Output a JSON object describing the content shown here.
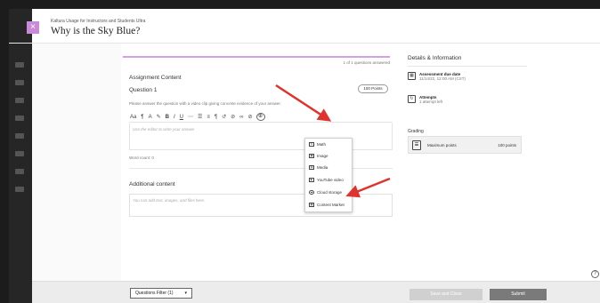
{
  "header": {
    "breadcrumb": "Kaltura Usage for Instructors and Students Ultra",
    "title": "Why is the Sky Blue?",
    "close_symbol": "×"
  },
  "assignment": {
    "progress_text": "1 of 1 questions answered",
    "section_title": "Assignment Content",
    "question_label": "Question 1",
    "points_badge": "100 Points",
    "instructions": "Please answer the question with a video clip giving concrete evidence of your answer.",
    "editor_placeholder": "Use the editor to write your answer",
    "word_count": "Word count: 0",
    "toolbar": [
      "Aa",
      "¶",
      "A",
      "✎",
      "B",
      "I",
      "U",
      "⋯",
      "☰",
      "≡",
      "¶",
      "↺",
      "⊘",
      "∞",
      "⊘",
      "⊕"
    ]
  },
  "additional": {
    "title": "Additional content",
    "placeholder": "You can add text, images, and files here."
  },
  "insert_menu": {
    "items": [
      {
        "label": "Math",
        "icon": "math-icon",
        "glyph": "fx"
      },
      {
        "label": "Image",
        "icon": "image-icon",
        "glyph": "▣"
      },
      {
        "label": "Media",
        "icon": "media-icon",
        "glyph": "▤"
      },
      {
        "label": "YouTube video",
        "icon": "youtube-icon",
        "glyph": "▶"
      },
      {
        "label": "Cloud storage",
        "icon": "cloud-icon",
        "glyph": "☁"
      },
      {
        "label": "Content Market",
        "icon": "content-market-icon",
        "glyph": "▦"
      }
    ]
  },
  "details": {
    "title": "Details & Information",
    "due_label": "Assessment due date",
    "due_value": "11/14/22, 12:00 AM (CST)",
    "attempts_label": "Attempts",
    "attempts_value": "1 attempt left",
    "grading_label": "Grading",
    "max_points_label": "Maximum points",
    "max_points_value": "100 points"
  },
  "footer": {
    "question_filter": "Questions Filter (1)",
    "save_label": "Save and Close",
    "submit_label": "Submit"
  },
  "colors": {
    "accent_purple": "#c78ad6",
    "arrow_red": "#e0332e",
    "dark_sidebar": "#262626"
  }
}
